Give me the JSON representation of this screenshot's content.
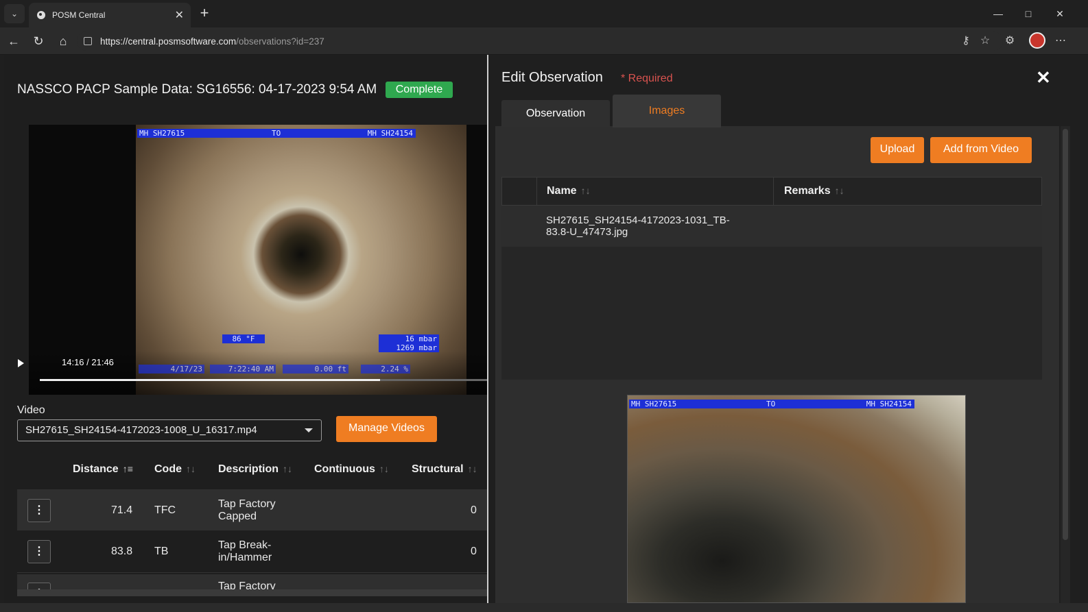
{
  "browser": {
    "tab_title": "POSM Central",
    "url_host": "https://central.posmsoftware.com",
    "url_path": "/observations?id=237",
    "icons": [
      "tab-menu-icon",
      "close-icon",
      "new-tab-icon",
      "minimize-icon",
      "maximize-icon",
      "close-window-icon",
      "back-icon",
      "refresh-icon",
      "home-icon",
      "lock-icon",
      "key-icon",
      "favorite-star-icon",
      "extensions-icon",
      "profile-avatar",
      "more-icon"
    ]
  },
  "inspection": {
    "title": "NASSCO PACP Sample Data: SG16556: 04-17-2023 9:54 AM",
    "status": "Complete",
    "status_color": "#2fa84f"
  },
  "video_player": {
    "time": "14:16 / 21:46",
    "progress_fraction": 0.76,
    "osd_top_left": "MH SH27615",
    "osd_top_mid": "TO",
    "osd_top_right": "MH SH24154",
    "osd_temp": "86 °F",
    "osd_pressure": "16 mbar\n1269 mbar",
    "osd_date": "4/17/23",
    "osd_clock": "7:22:40 AM",
    "osd_distance": "0.00 ft",
    "osd_incline": "2.24 %"
  },
  "video_select": {
    "label": "Video",
    "value": "SH27615_SH24154-4172023-1008_U_16317.mp4",
    "manage_button": "Manage Videos"
  },
  "observations_table": {
    "columns": [
      "Distance",
      "Code",
      "Description",
      "Continuous",
      "Structural"
    ],
    "rows": [
      {
        "distance": "71.4",
        "code": "TFC",
        "description_l1": "Tap Factory",
        "description_l2": "Capped",
        "continuous": "",
        "structural": "0"
      },
      {
        "distance": "83.8",
        "code": "TB",
        "description_l1": "Tap Break-",
        "description_l2": "in/Hammer",
        "continuous": "",
        "structural": "0"
      },
      {
        "distance": "",
        "code": "",
        "description_l1": "Tap Factory",
        "description_l2": "",
        "continuous": "",
        "structural": ""
      }
    ]
  },
  "edit_panel": {
    "title": "Edit Observation",
    "required_note": "* Required",
    "tabs": [
      "Observation",
      "Images"
    ],
    "active_tab": "Images",
    "upload_button": "Upload",
    "add_from_video_button": "Add from Video",
    "images_table": {
      "columns": [
        "Name",
        "Remarks"
      ],
      "rows": [
        {
          "name_l1": "SH27615_SH24154-4172023-1031_TB-",
          "name_l2": "83.8-U_47473.jpg",
          "remarks": ""
        }
      ]
    },
    "preview_osd_left": "MH SH27615",
    "preview_osd_mid": "TO",
    "preview_osd_right": "MH SH24154"
  },
  "colors": {
    "accent_orange": "#ef7d22",
    "required_red": "#d9534f",
    "osd_blue": "#1d2fd6"
  }
}
